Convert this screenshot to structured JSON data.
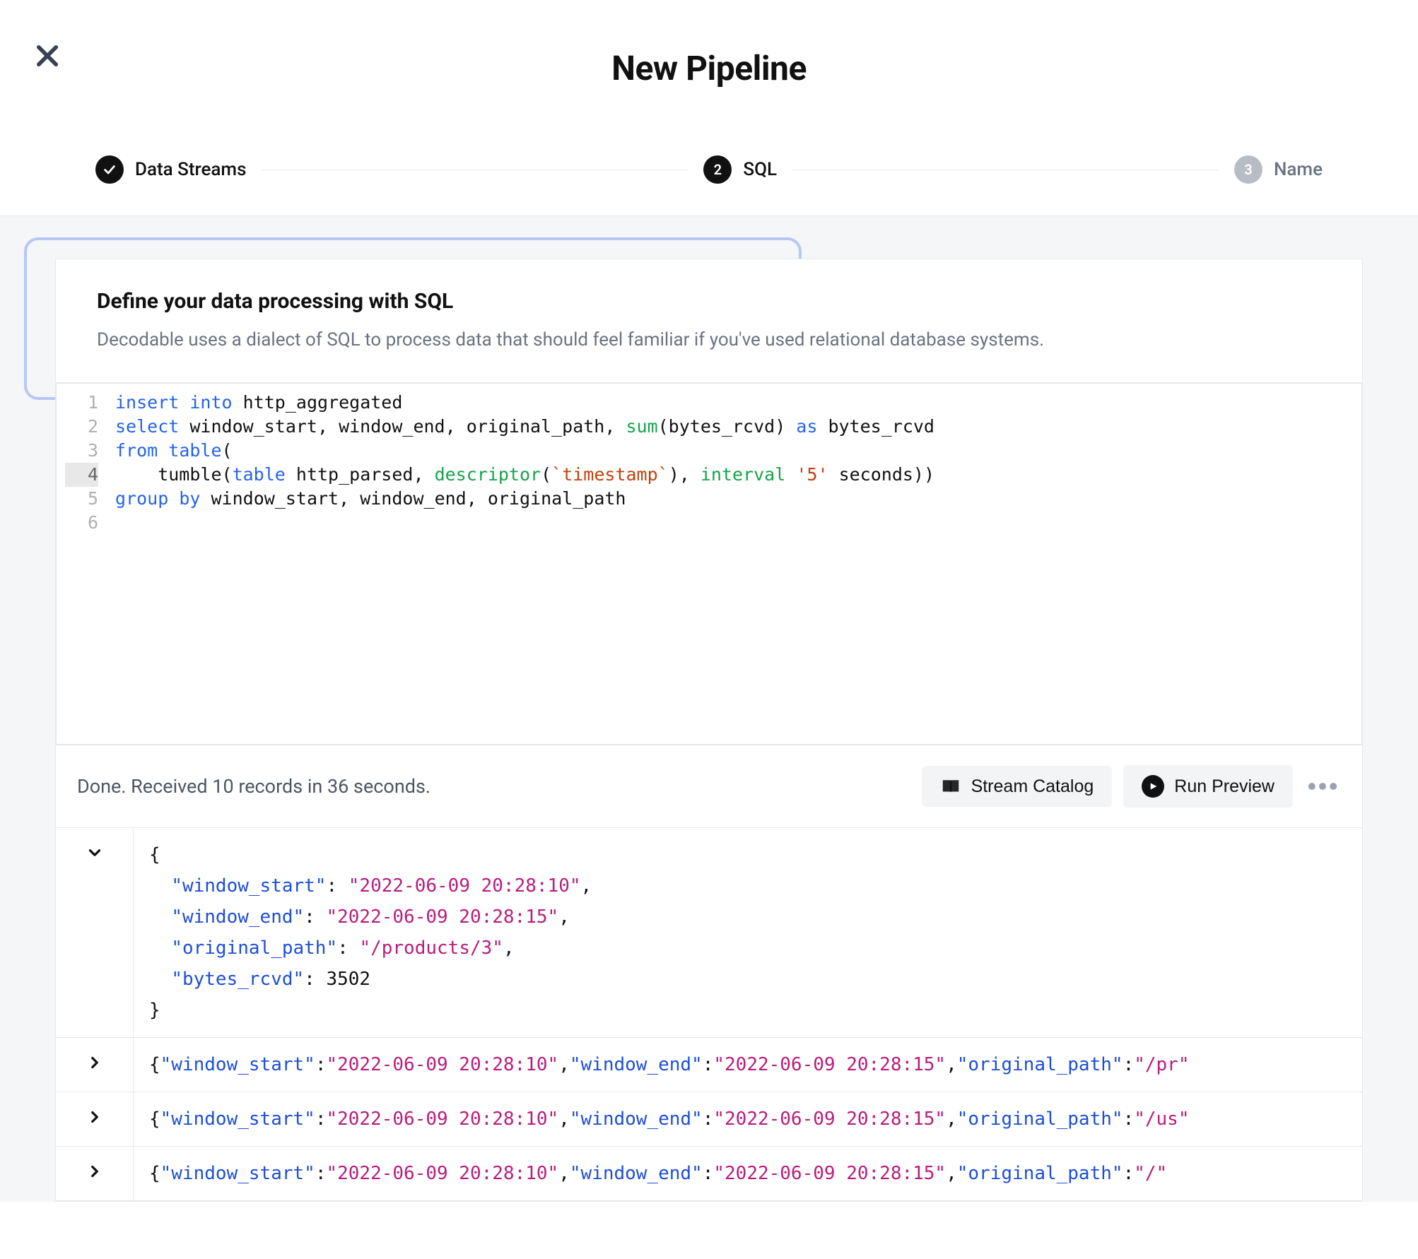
{
  "header": {
    "title": "New Pipeline"
  },
  "stepper": {
    "steps": [
      {
        "label": "Data Streams",
        "state": "done"
      },
      {
        "label": "SQL",
        "state": "current",
        "number": "2"
      },
      {
        "label": "Name",
        "state": "pending",
        "number": "3"
      }
    ]
  },
  "card": {
    "title": "Define your data processing with SQL",
    "description": "Decodable uses a dialect of SQL to process data that should feel familiar if you've used relational database systems."
  },
  "sql": {
    "lines": [
      "insert into http_aggregated",
      "select window_start, window_end, original_path, sum(bytes_rcvd) as bytes_rcvd",
      "from table(",
      "    tumble(table http_parsed, descriptor(`timestamp`), interval '5' seconds))",
      "group by window_start, window_end, original_path",
      ""
    ],
    "active_line": 4
  },
  "runbar": {
    "status": "Done. Received 10 records in 36 seconds.",
    "catalog_label": "Stream Catalog",
    "run_label": "Run Preview"
  },
  "results": [
    {
      "expanded": true,
      "record": {
        "window_start": "2022-06-09 20:28:10",
        "window_end": "2022-06-09 20:28:15",
        "original_path": "/products/3",
        "bytes_rcvd": 3502
      }
    },
    {
      "expanded": false,
      "record": {
        "window_start": "2022-06-09 20:28:10",
        "window_end": "2022-06-09 20:28:15",
        "original_path": "/pr"
      }
    },
    {
      "expanded": false,
      "record": {
        "window_start": "2022-06-09 20:28:10",
        "window_end": "2022-06-09 20:28:15",
        "original_path": "/us"
      }
    },
    {
      "expanded": false,
      "record": {
        "window_start": "2022-06-09 20:28:10",
        "window_end": "2022-06-09 20:28:15",
        "original_path": "/"
      }
    }
  ]
}
